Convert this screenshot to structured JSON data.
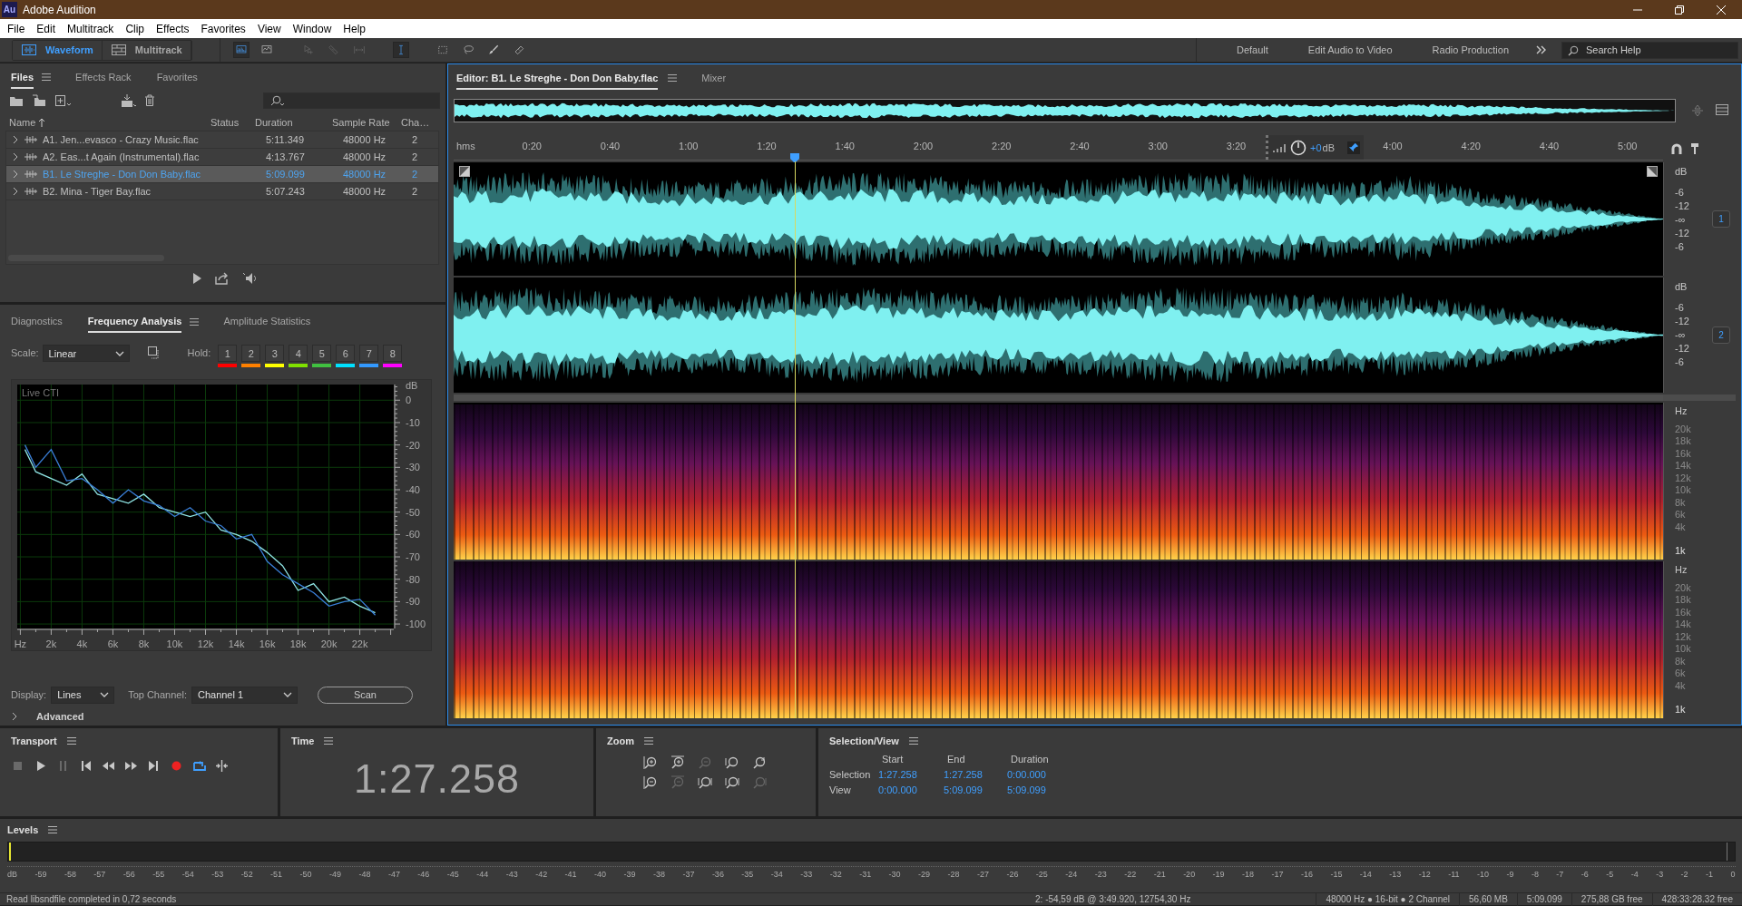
{
  "window": {
    "logo": "Au",
    "title": "Adobe Audition"
  },
  "menu": [
    "File",
    "Edit",
    "Multitrack",
    "Clip",
    "Effects",
    "Favorites",
    "View",
    "Window",
    "Help"
  ],
  "toolbar": {
    "modes": [
      {
        "label": "Waveform",
        "kind": "waveform",
        "selected": true
      },
      {
        "label": "Multitrack",
        "kind": "multitrack",
        "selected": false
      }
    ],
    "tools": [
      {
        "kind": "spectral-frequency",
        "selected": true,
        "disabled": false
      },
      {
        "kind": "spectral-pitch",
        "selected": false,
        "disabled": false
      },
      {
        "kind": "move",
        "selected": false,
        "disabled": true
      },
      {
        "kind": "razor",
        "selected": false,
        "disabled": true
      },
      {
        "kind": "slip",
        "selected": false,
        "disabled": true
      },
      {
        "kind": "time-selection",
        "selected": true,
        "disabled": false
      },
      {
        "kind": "marquee",
        "selected": false,
        "disabled": false
      },
      {
        "kind": "lasso",
        "selected": false,
        "disabled": false
      },
      {
        "kind": "brush",
        "selected": false,
        "disabled": false
      },
      {
        "kind": "healing",
        "selected": false,
        "disabled": false
      }
    ],
    "workspaces": [
      "Default",
      "Edit Audio to Video",
      "Radio Production"
    ],
    "search": {
      "placeholder": "Search Help"
    }
  },
  "files_panel": {
    "tabs": [
      {
        "label": "Files",
        "selected": true
      },
      {
        "label": "Effects Rack",
        "selected": false
      },
      {
        "label": "Favorites",
        "selected": false
      }
    ],
    "columns": [
      "Name",
      "Status",
      "Duration",
      "Sample Rate",
      "Cha…"
    ],
    "rows": [
      {
        "name": "A1. Jen...evasco - Crazy Music.flac",
        "duration": "5:11.349",
        "rate": "48000 Hz",
        "channels": "2",
        "selected": false
      },
      {
        "name": "A2. Eas...t Again (Instrumental).flac",
        "duration": "4:13.767",
        "rate": "48000 Hz",
        "channels": "2",
        "selected": false
      },
      {
        "name": "B1. Le Streghe - Don Don Baby.flac",
        "duration": "5:09.099",
        "rate": "48000 Hz",
        "channels": "2",
        "selected": true
      },
      {
        "name": "B2. Mina - Tiger Bay.flac",
        "duration": "5:07.243",
        "rate": "48000 Hz",
        "channels": "2",
        "selected": false
      }
    ]
  },
  "analysis_panel": {
    "tabs": [
      {
        "label": "Diagnostics",
        "selected": false
      },
      {
        "label": "Frequency Analysis",
        "selected": true
      },
      {
        "label": "Amplitude Statistics",
        "selected": false
      }
    ],
    "scale_label": "Scale:",
    "scale": "Linear",
    "hold_label": "Hold:",
    "hold": [
      {
        "label": "1",
        "color": "#ff0000"
      },
      {
        "label": "2",
        "color": "#ff8000"
      },
      {
        "label": "3",
        "color": "#ffff00"
      },
      {
        "label": "4",
        "color": "#80e000"
      },
      {
        "label": "5",
        "color": "#40c040"
      },
      {
        "label": "6",
        "color": "#00e0ff"
      },
      {
        "label": "7",
        "color": "#3399ff"
      },
      {
        "label": "8",
        "color": "#ff00ff"
      }
    ],
    "chart_data": {
      "type": "line",
      "title": "Live CTI",
      "ylabel": "dB",
      "x": [
        0.3,
        1,
        2,
        3,
        4,
        5,
        6,
        7,
        8,
        9,
        10,
        11,
        12,
        13,
        14,
        15,
        16,
        17,
        18,
        19,
        20,
        21,
        22,
        23
      ],
      "series": [
        {
          "color": "#8fe4e4",
          "values": [
            -22,
            -32,
            -35,
            -38,
            -33,
            -42,
            -44,
            -46,
            -42,
            -48,
            -50,
            -52,
            -50,
            -58,
            -60,
            -63,
            -68,
            -74,
            -85,
            -82,
            -90,
            -88,
            -92,
            -95
          ]
        },
        {
          "color": "#3a7fd8",
          "values": [
            -20,
            -30,
            -22,
            -36,
            -35,
            -40,
            -46,
            -40,
            -45,
            -47,
            -52,
            -48,
            -54,
            -56,
            -62,
            -60,
            -72,
            -78,
            -82,
            -86,
            -92,
            -90,
            -89,
            -96
          ]
        }
      ],
      "xlim": [
        -0.2,
        24.2
      ],
      "ylim": [
        -102,
        7
      ],
      "grid": true,
      "xticks": [
        {
          "value": 0,
          "label": "Hz"
        },
        {
          "value": 2,
          "label": "2k"
        },
        {
          "value": 4,
          "label": "4k"
        },
        {
          "value": 6,
          "label": "6k"
        },
        {
          "value": 8,
          "label": "8k"
        },
        {
          "value": 10,
          "label": "10k"
        },
        {
          "value": 12,
          "label": "12k"
        },
        {
          "value": 14,
          "label": "14k"
        },
        {
          "value": 16,
          "label": "16k"
        },
        {
          "value": 18,
          "label": "18k"
        },
        {
          "value": 20,
          "label": "20k"
        },
        {
          "value": 22,
          "label": "22k"
        }
      ],
      "yticks": [
        0,
        -10,
        -20,
        -30,
        -40,
        -50,
        -60,
        -70,
        -80,
        -90,
        -100
      ]
    },
    "display_label": "Display:",
    "display": "Lines",
    "channel_label": "Top Channel:",
    "channel": "Channel 1",
    "scan": "Scan",
    "advanced": "Advanced"
  },
  "editor": {
    "tabs": [
      {
        "label": "Editor: B1. Le Streghe - Don Don Baby.flac",
        "selected": true
      },
      {
        "label": "Mixer",
        "selected": false
      }
    ],
    "ruler": {
      "unit": "hms",
      "ticks": [
        "0:20",
        "0:40",
        "1:00",
        "1:20",
        "1:40",
        "2:00",
        "2:20",
        "2:40",
        "3:00",
        "3:20",
        "4:00",
        "4:20",
        "4:40",
        "5:00"
      ]
    },
    "playhead": {
      "level": 0.2823
    },
    "hud": {
      "gain": "+0",
      "unit": "dB"
    },
    "channels": [
      {
        "badge": "1",
        "scale": [
          "dB",
          "-6",
          "-12",
          "-∞",
          "-12",
          "-6"
        ]
      },
      {
        "badge": "2",
        "scale": [
          "dB",
          "-6",
          "-12",
          "-∞",
          "-12",
          "-6"
        ]
      }
    ],
    "spectrograms": [
      {
        "scale": [
          "Hz",
          "20k",
          "18k",
          "16k",
          "14k",
          "12k",
          "10k",
          "8k",
          "6k",
          "4k",
          "1k"
        ]
      },
      {
        "scale": [
          "Hz",
          "20k",
          "18k",
          "16k",
          "14k",
          "12k",
          "10k",
          "8k",
          "6k",
          "4k",
          "1k"
        ]
      }
    ]
  },
  "transport": {
    "title": "Transport",
    "buttons": [
      {
        "kind": "stop",
        "disabled": true,
        "on": false
      },
      {
        "kind": "play",
        "disabled": false,
        "on": false
      },
      {
        "kind": "pause",
        "disabled": true,
        "on": false
      },
      {
        "kind": "start",
        "disabled": false,
        "on": false
      },
      {
        "kind": "rewind",
        "disabled": false,
        "on": false
      },
      {
        "kind": "forward",
        "disabled": false,
        "on": false
      },
      {
        "kind": "end",
        "disabled": false,
        "on": false
      },
      {
        "kind": "record",
        "disabled": false,
        "on": false
      },
      {
        "kind": "loop",
        "disabled": false,
        "on": true
      },
      {
        "kind": "skip",
        "disabled": false,
        "on": false
      }
    ]
  },
  "time": {
    "title": "Time",
    "value": "1:27.258"
  },
  "zoom": {
    "title": "Zoom",
    "buttons": [
      {
        "kind": "in-amplitude",
        "disabled": false
      },
      {
        "kind": "in-time",
        "disabled": false
      },
      {
        "kind": "full",
        "disabled": true
      },
      {
        "kind": "in-left",
        "disabled": false
      },
      {
        "kind": "reset",
        "disabled": false
      },
      {
        "kind": "out-amplitude",
        "disabled": false
      },
      {
        "kind": "out-time",
        "disabled": true
      },
      {
        "kind": "in-right",
        "disabled": false
      },
      {
        "kind": "selection",
        "disabled": false
      },
      {
        "kind": "out-right",
        "disabled": true
      }
    ]
  },
  "selection": {
    "title": "Selection/View",
    "columns": [
      "Start",
      "End",
      "Duration"
    ],
    "rows": [
      {
        "label": "Selection",
        "values": [
          "1:27.258",
          "1:27.258",
          "0:00.000"
        ]
      },
      {
        "label": "View",
        "values": [
          "0:00.000",
          "5:09.099",
          "5:09.099"
        ]
      }
    ]
  },
  "levels": {
    "title": "Levels",
    "scale": [
      "dB",
      "-59",
      "-58",
      "-57",
      "-56",
      "-55",
      "-54",
      "-53",
      "-52",
      "-51",
      "-50",
      "-49",
      "-48",
      "-47",
      "-46",
      "-45",
      "-44",
      "-43",
      "-42",
      "-41",
      "-40",
      "-39",
      "-38",
      "-37",
      "-36",
      "-35",
      "-34",
      "-33",
      "-32",
      "-31",
      "-30",
      "-29",
      "-28",
      "-27",
      "-26",
      "-25",
      "-24",
      "-23",
      "-22",
      "-21",
      "-20",
      "-19",
      "-18",
      "-17",
      "-16",
      "-15",
      "-14",
      "-13",
      "-12",
      "-11",
      "-10",
      "-9",
      "-8",
      "-7",
      "-6",
      "-5",
      "-4",
      "-3",
      "-2",
      "-1",
      "0"
    ]
  },
  "status_bar": {
    "message": "Read libsndfile completed in 0,72 seconds",
    "cursor": "2: -54,59 dB @ 3:49.920, 12754,30 Hz",
    "format": "48000 Hz ● 16-bit ● 2 Channel",
    "size": "56,60 MB",
    "duration": "5:09.099",
    "disk": "275,88 GB free",
    "time_free": "428:33:28.32 free"
  }
}
